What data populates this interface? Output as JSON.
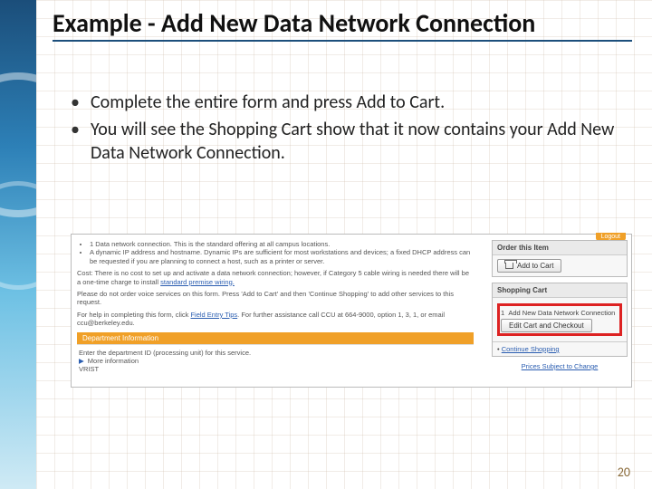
{
  "title": "Example - Add New Data Network Connection",
  "bullets": [
    "Complete the entire form and press Add to Cart.",
    "You will see the Shopping Cart show that it now contains your Add New Data Network Connection."
  ],
  "page_number": "20",
  "screenshot": {
    "logout": "Logout",
    "intro_items": [
      "1 Data network connection. This is the standard offering at all campus locations.",
      "A dynamic IP address and hostname. Dynamic IPs are sufficient for most workstations and devices; a fixed DHCP address can be requested if you are planning to connect a host, such as a printer or server."
    ],
    "cost_line_prefix": "Cost: There is no cost to set up and activate a data network connection; however, if Category 5 cable wiring is needed there will be a one-time charge to install ",
    "cost_link": "standard premise wiring.",
    "voice_line": "Please do not order voice services on this form. Press 'Add to Cart' and then 'Continue Shopping' to add other services to this request.",
    "help_prefix": "For help in completing this form, click ",
    "help_link": "Field Entry Tips",
    "help_suffix": ". For further assistance call CCU at 664-9000, option 1, 3, 1, or email ccu@berkeley.edu.",
    "dept_header": "Department Information",
    "dept_line": "Enter the department ID (processing unit) for this service.",
    "more_info": "More information",
    "dept_value": "VRIST",
    "order_panel": {
      "header": "Order this Item",
      "button": "Add to Cart"
    },
    "cart_panel": {
      "header": "Shopping Cart",
      "qty": "1",
      "item": "Add New Data Network Connection",
      "edit_button": "Edit Cart and Checkout",
      "continue": "Continue Shopping"
    },
    "prices_note": "Prices Subject to Change"
  }
}
